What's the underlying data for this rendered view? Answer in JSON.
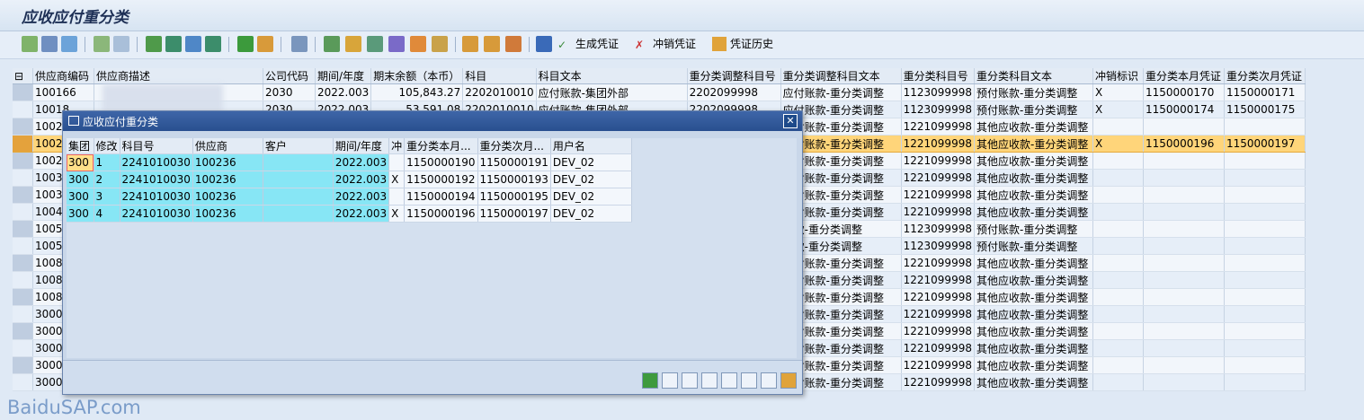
{
  "app": {
    "title": "应收应付重分类"
  },
  "toolbar": {
    "generate_voucher": "生成凭证",
    "reverse_voucher": "冲销凭证",
    "voucher_history": "凭证历史"
  },
  "grid": {
    "columns": [
      "供应商编码",
      "供应商描述",
      "公司代码",
      "期间/年度",
      "期末余额（本币）",
      "科目",
      "科目文本",
      "重分类调整科目号",
      "重分类调整科目文本",
      "重分类科目号",
      "重分类科目文本",
      "冲销标识",
      "重分类本月凭证",
      "重分类次月凭证"
    ],
    "rows": [
      {
        "vendor": "100166",
        "desc": "",
        "company": "2030",
        "period": "2022.003",
        "balance": "105,843.27",
        "account": "2202010010",
        "acc_text": "应付账款-集团外部",
        "adj_no": "2202099998",
        "adj_text": "应付账款-重分类调整",
        "rc_no": "1123099998",
        "rc_text": "预付账款-重分类调整",
        "rev": "X",
        "cur": "1150000170",
        "next": "1150000171"
      },
      {
        "vendor": "10018",
        "desc": "",
        "company": "2030",
        "period": "2022.003",
        "balance": "53,591.08",
        "account": "2202010010",
        "acc_text": "应付账款-集团外部",
        "adj_no": "2202099998",
        "adj_text": "应付账款-重分类调整",
        "rc_no": "1123099998",
        "rc_text": "预付账款-重分类调整",
        "rev": "X",
        "cur": "1150000174",
        "next": "1150000175"
      },
      {
        "vendor": "1002",
        "adj_text": "应付账款-重分类调整",
        "rc_no": "1221099998",
        "rc_text": "其他应收款-重分类调整",
        "rev": "",
        "cur": "",
        "next": ""
      },
      {
        "vendor": "1002",
        "adj_text": "应付账款-重分类调整",
        "rc_no": "1221099998",
        "rc_text": "其他应收款-重分类调整",
        "rev": "X",
        "cur": "1150000196",
        "next": "1150000197"
      },
      {
        "vendor": "1002",
        "adj_text": "应付账款-重分类调整",
        "rc_no": "1221099998",
        "rc_text": "其他应收款-重分类调整",
        "rev": "",
        "cur": "",
        "next": ""
      },
      {
        "vendor": "1003",
        "adj_text": "应付账款-重分类调整",
        "rc_no": "1221099998",
        "rc_text": "其他应收款-重分类调整",
        "rev": "",
        "cur": "",
        "next": ""
      },
      {
        "vendor": "1003",
        "adj_text": "应付账款-重分类调整",
        "rc_no": "1221099998",
        "rc_text": "其他应收款-重分类调整",
        "rev": "",
        "cur": "",
        "next": ""
      },
      {
        "vendor": "1004",
        "adj_text": "应付账款-重分类调整",
        "rc_no": "1221099998",
        "rc_text": "其他应收款-重分类调整",
        "rev": "",
        "cur": "",
        "next": ""
      },
      {
        "vendor": "1005",
        "adj_text": "账款-重分类调整",
        "rc_no": "1123099998",
        "rc_text": "预付账款-重分类调整",
        "rev": "",
        "cur": "",
        "next": ""
      },
      {
        "vendor": "1005",
        "adj_text": "账款-重分类调整",
        "rc_no": "1123099998",
        "rc_text": "预付账款-重分类调整",
        "rev": "",
        "cur": "",
        "next": ""
      },
      {
        "vendor": "1008",
        "adj_text": "应付账款-重分类调整",
        "rc_no": "1221099998",
        "rc_text": "其他应收款-重分类调整",
        "rev": "",
        "cur": "",
        "next": ""
      },
      {
        "vendor": "1008",
        "adj_text": "应付账款-重分类调整",
        "rc_no": "1221099998",
        "rc_text": "其他应收款-重分类调整",
        "rev": "",
        "cur": "",
        "next": ""
      },
      {
        "vendor": "1008",
        "adj_text": "应付账款-重分类调整",
        "rc_no": "1221099998",
        "rc_text": "其他应收款-重分类调整",
        "rev": "",
        "cur": "",
        "next": ""
      },
      {
        "vendor": "3000",
        "adj_text": "应付账款-重分类调整",
        "rc_no": "1221099998",
        "rc_text": "其他应收款-重分类调整",
        "rev": "",
        "cur": "",
        "next": ""
      },
      {
        "vendor": "3000",
        "adj_text": "应付账款-重分类调整",
        "rc_no": "1221099998",
        "rc_text": "其他应收款-重分类调整",
        "rev": "",
        "cur": "",
        "next": ""
      },
      {
        "vendor": "3000",
        "adj_text": "应付账款-重分类调整",
        "rc_no": "1221099998",
        "rc_text": "其他应收款-重分类调整",
        "rev": "",
        "cur": "",
        "next": ""
      },
      {
        "vendor": "3000",
        "adj_text": "应付账款-重分类调整",
        "rc_no": "1221099998",
        "rc_text": "其他应收款-重分类调整",
        "rev": "",
        "cur": "",
        "next": ""
      },
      {
        "vendor": "3000",
        "adj_text": "应付账款-重分类调整",
        "rc_no": "1221099998",
        "rc_text": "其他应收款-重分类调整",
        "rev": "",
        "cur": "",
        "next": ""
      }
    ]
  },
  "dialog": {
    "title": "应收应付重分类",
    "columns": [
      "集团",
      "修改",
      "科目号",
      "供应商",
      "客户",
      "期间/年度",
      "冲",
      "重分类本月...",
      "重分类次月...",
      "用户名"
    ],
    "rows": [
      {
        "group": "300",
        "seq": "1",
        "account": "2241010030",
        "vendor": "100236",
        "customer": "",
        "period": "2022.003",
        "rev": "",
        "cur": "1150000190",
        "next": "1150000191",
        "user": "DEV_02"
      },
      {
        "group": "300",
        "seq": "2",
        "account": "2241010030",
        "vendor": "100236",
        "customer": "",
        "period": "2022.003",
        "rev": "X",
        "cur": "1150000192",
        "next": "1150000193",
        "user": "DEV_02"
      },
      {
        "group": "300",
        "seq": "3",
        "account": "2241010030",
        "vendor": "100236",
        "customer": "",
        "period": "2022.003",
        "rev": "",
        "cur": "1150000194",
        "next": "1150000195",
        "user": "DEV_02"
      },
      {
        "group": "300",
        "seq": "4",
        "account": "2241010030",
        "vendor": "100236",
        "customer": "",
        "period": "2022.003",
        "rev": "X",
        "cur": "1150000196",
        "next": "1150000197",
        "user": "DEV_02"
      }
    ]
  },
  "watermark": "BaiduSAP.com",
  "colors": {
    "highlight_row": "#ffd57a",
    "dialog_title": "#294f8f",
    "cyan_cell": "#87e6f5"
  }
}
